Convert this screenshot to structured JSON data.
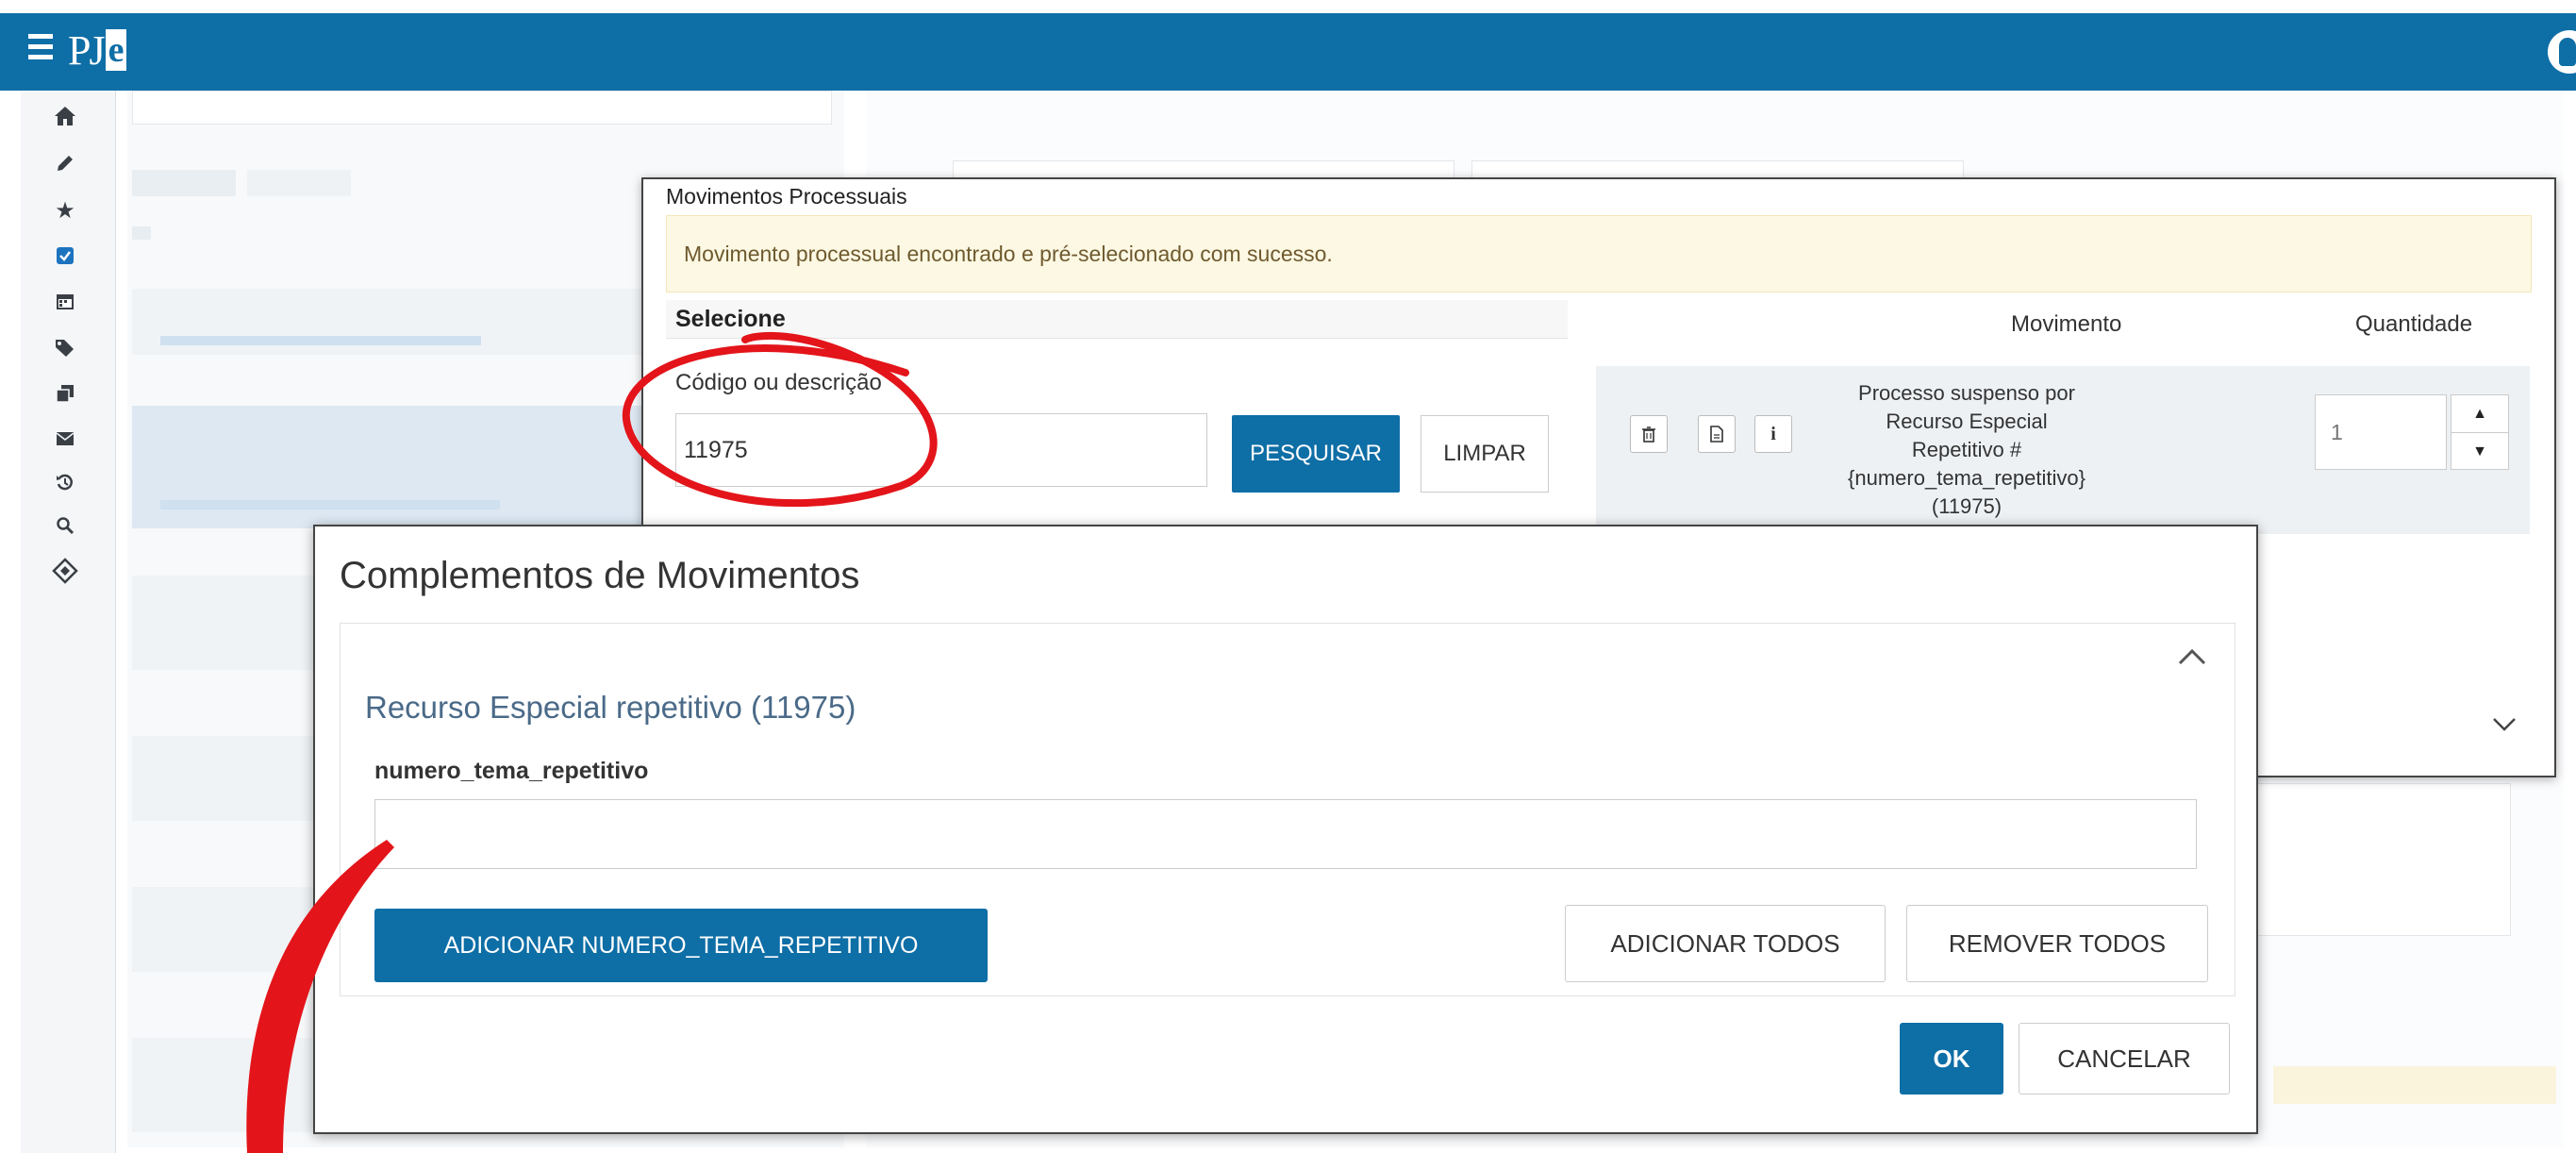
{
  "app": {
    "logo_text": "PJ",
    "logo_e": "e"
  },
  "modal_movimentos": {
    "title": "Movimentos Processuais",
    "alert": "Movimento processual encontrado e pré-selecionado com sucesso.",
    "select_header": "Selecione",
    "search_label": "Código ou descrição",
    "search_value": "11975",
    "search_button": "PESQUISAR",
    "clear_button": "LIMPAR",
    "col_movimento": "Movimento",
    "col_quantidade": "Quantidade",
    "row": {
      "desc_line1": "Processo suspenso por Recurso Especial",
      "desc_line2": "Repetitivo #{numero_tema_repetitivo}",
      "desc_line3": "(11975)",
      "quantity": "1"
    }
  },
  "modal_complementos": {
    "title": "Complementos de Movimentos",
    "section_title": "Recurso Especial repetitivo (11975)",
    "field_label": "numero_tema_repetitivo",
    "field_value": "",
    "add_button": "ADICIONAR NUMERO_TEMA_REPETITIVO",
    "add_all_button": "ADICIONAR TODOS",
    "remove_all_button": "REMOVER TODOS",
    "ok_button": "OK",
    "cancel_button": "CANCELAR"
  },
  "icons": {
    "menu": "hamburger-icon",
    "user": "user-icon",
    "sidebar": [
      "home-icon",
      "pencil-icon",
      "star-icon",
      "checkbox-icon",
      "calendar-icon",
      "tags-icon",
      "copy-icon",
      "envelope-icon",
      "history-icon",
      "search-icon",
      "move-icon"
    ],
    "row_actions": [
      "trash-icon",
      "document-icon",
      "info-icon"
    ]
  },
  "colors": {
    "primary": "#0e6ea6",
    "alert_bg": "#fcf8e3",
    "annotation_red": "#e3151a"
  }
}
